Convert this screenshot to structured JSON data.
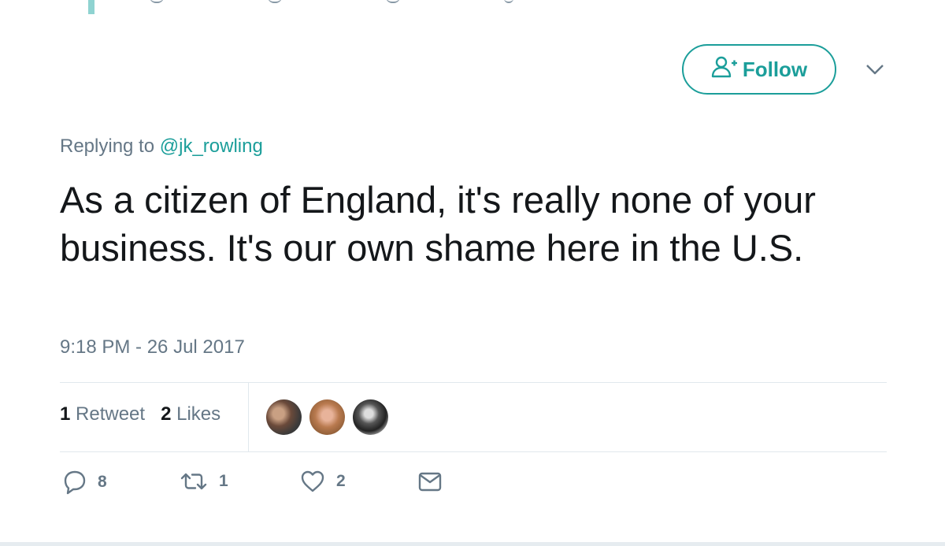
{
  "tweet": {
    "replying_prefix": "Replying to",
    "replying_handle": "@jk_rowling",
    "text": "As a citizen of England, it's really none of your business. It's our own shame here in the U.S.",
    "timestamp": "9:18 PM - 26 Jul 2017"
  },
  "header": {
    "follow_label": "Follow"
  },
  "stats": {
    "retweet_count": "1",
    "retweet_label": "Retweet",
    "like_count": "2",
    "like_label": "Likes"
  },
  "actions": {
    "reply_count": "8",
    "retweet_count": "1",
    "like_count": "2"
  },
  "colors": {
    "accent": "#1b9e9a",
    "muted_text": "#657786",
    "divider": "#e1e8ed"
  },
  "icons": [
    "follow-person-icon",
    "chevron-down-icon",
    "reply-icon",
    "retweet-icon",
    "like-icon",
    "message-icon"
  ]
}
